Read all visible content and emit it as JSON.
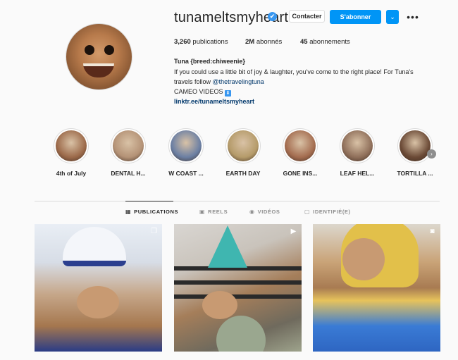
{
  "profile": {
    "username": "tunameltsmyheart",
    "verified_icon": "✔",
    "contact_label": "Contacter",
    "follow_label": "S'abonner",
    "dropdown_icon": "⌄",
    "more_icon": "•••"
  },
  "stats": {
    "posts_value": "3,260",
    "posts_label": "publications",
    "followers_value": "2M",
    "followers_label": "abonnés",
    "following_value": "45",
    "following_label": "abonnements"
  },
  "bio": {
    "name": "Tuna {breed:chiweenie}",
    "line1": "If you could use a little bit of joy & laughter, you've come to the right place! For Tuna's",
    "line2_prefix": "travels follow ",
    "mention": "@thetravelingtuna",
    "line3": "CAMEO VIDEOS",
    "download_icon": "⬇",
    "link": "linktr.ee/tunameltsmyheart"
  },
  "highlights": [
    {
      "label": "4th of July",
      "color": "#9c6a4a"
    },
    {
      "label": "DENTAL H...",
      "color": "#b49276"
    },
    {
      "label": "W COAST ...",
      "color": "#6b7fa3"
    },
    {
      "label": "EARTH DAY",
      "color": "#b59b6a"
    },
    {
      "label": "GONE INS...",
      "color": "#a46d50"
    },
    {
      "label": "LEAF HEL...",
      "color": "#8f6f5a"
    },
    {
      "label": "TORTILLA ...",
      "color": "#6b4a36"
    }
  ],
  "highlights_next_icon": "›",
  "tabs": [
    {
      "label": "PUBLICATIONS",
      "icon": "▦",
      "active": true
    },
    {
      "label": "REELS",
      "icon": "▣",
      "active": false
    },
    {
      "label": "VIDÉOS",
      "icon": "◉",
      "active": false
    },
    {
      "label": "IDENTIFIÉ(E)",
      "icon": "▢",
      "active": false
    }
  ],
  "posts": [
    {
      "badge_icon": "❐"
    },
    {
      "badge_icon": "▶"
    },
    {
      "badge_icon": "◙"
    }
  ]
}
